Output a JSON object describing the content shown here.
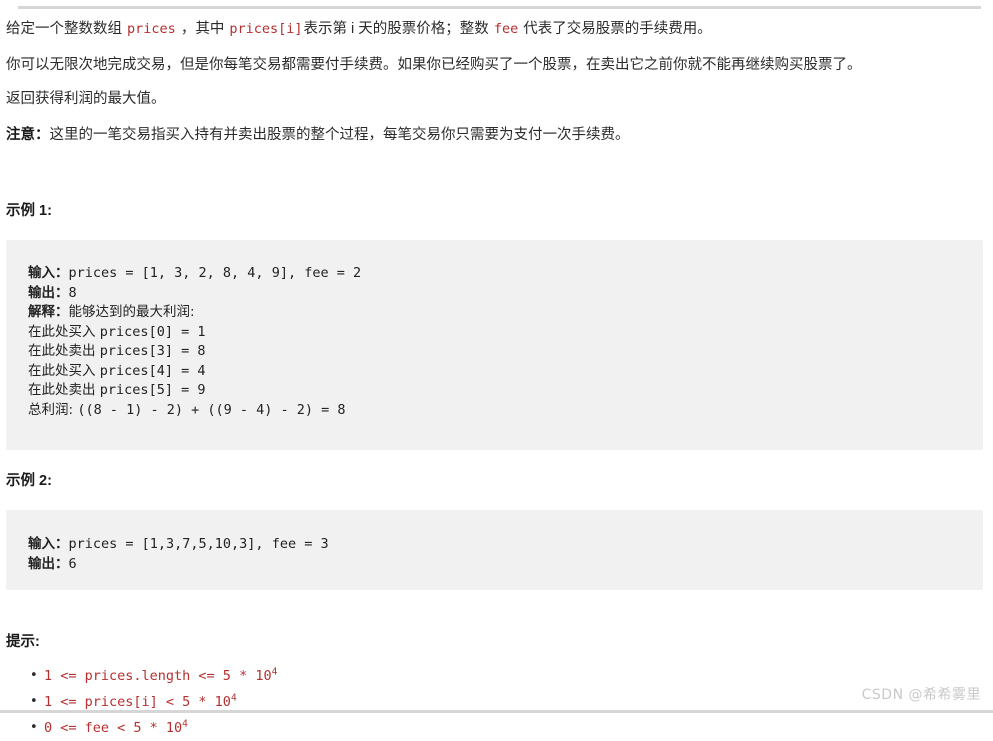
{
  "document": {
    "top_divider": true,
    "bottom_divider": true,
    "paragraphs": [
      {
        "id": "p-definition",
        "segments": [
          {
            "type": "text",
            "value": "给定一个整数数组 "
          },
          {
            "type": "code",
            "value": "prices"
          },
          {
            "type": "text",
            "value": " ，其中 "
          },
          {
            "type": "code",
            "value": "prices[i]"
          },
          {
            "type": "text",
            "value": "表示第 i 天的股票价格；整数 "
          },
          {
            "type": "code",
            "value": "fee"
          },
          {
            "type": "text",
            "value": " 代表了交易股票的手续费用。"
          }
        ]
      },
      {
        "id": "p-rules",
        "segments": [
          {
            "type": "text",
            "value": "你可以无限次地完成交易，但是你每笔交易都需要付手续费。如果你已经购买了一个股票，在卖出它之前你就不能再继续购买股票了。"
          }
        ]
      },
      {
        "id": "p-return",
        "segments": [
          {
            "type": "text",
            "value": "返回获得利润的最大值。"
          }
        ]
      },
      {
        "id": "p-note",
        "segments": [
          {
            "type": "strong",
            "value": "注意："
          },
          {
            "type": "text",
            "value": "这里的一笔交易指买入持有并卖出股票的整个过程，每笔交易你只需要为支付一次手续费。"
          }
        ]
      }
    ],
    "examples": [
      {
        "title": "示例 1:",
        "lines": [
          {
            "label": "输入：",
            "code": "prices = [1, 3, 2, 8, 4, 9], fee = 2"
          },
          {
            "label": "输出：",
            "code": "8"
          },
          {
            "label": "解释：",
            "code": "",
            "cn": "能够达到的最大利润:"
          },
          {
            "label": "",
            "cn": "在此处买入 ",
            "code": "prices[0] = 1"
          },
          {
            "label": "",
            "cn": "在此处卖出 ",
            "code": "prices[3] = 8"
          },
          {
            "label": "",
            "cn": "在此处买入 ",
            "code": "prices[4] = 4"
          },
          {
            "label": "",
            "cn": "在此处卖出 ",
            "code": "prices[5] = 9"
          },
          {
            "label": "",
            "cn": "总利润: ",
            "code": "((8 - 1) - 2) + ((9 - 4) - 2) = 8"
          }
        ]
      },
      {
        "title": "示例 2:",
        "lines": [
          {
            "label": "输入：",
            "code": "prices = [1,3,7,5,10,3], fee = 3"
          },
          {
            "label": "输出：",
            "code": "6"
          }
        ]
      }
    ],
    "hints": {
      "title": "提示:",
      "constraints": [
        {
          "base": "1 <= prices.length <= 5 * 10",
          "exp": "4"
        },
        {
          "base": "1 <= prices[i] < 5 * 10",
          "exp": "4"
        },
        {
          "base": "0 <= fee < 5 * 10",
          "exp": "4"
        }
      ]
    },
    "watermark": "CSDN @希希雾里",
    "colors": {
      "inline_code": "#b5302f",
      "code_block_bg": "#f1f1f1",
      "divider": "#d6d6d6",
      "watermark": "#c9c9c9"
    }
  }
}
